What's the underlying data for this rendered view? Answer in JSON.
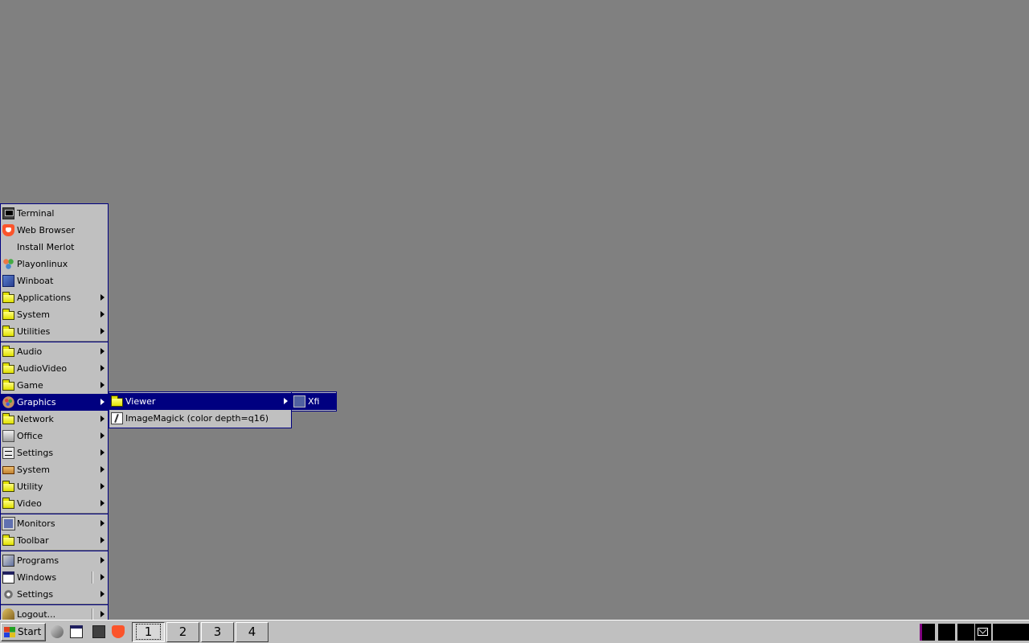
{
  "main_menu": {
    "section1": [
      {
        "label": "Terminal",
        "icon": "terminal-icon",
        "submenu": false
      },
      {
        "label": "Web Browser",
        "icon": "brave-icon",
        "submenu": false
      },
      {
        "label": "Install Merlot",
        "icon": "",
        "submenu": false
      },
      {
        "label": "Playonlinux",
        "icon": "playonlinux-icon",
        "submenu": false
      },
      {
        "label": "Winboat",
        "icon": "winboat-icon",
        "submenu": false
      },
      {
        "label": "Applications",
        "icon": "folder-icon",
        "submenu": true
      },
      {
        "label": "System",
        "icon": "folder-icon",
        "submenu": true
      },
      {
        "label": "Utilities",
        "icon": "folder-icon",
        "submenu": true
      }
    ],
    "section2": [
      {
        "label": "Audio",
        "icon": "folder-icon",
        "submenu": true
      },
      {
        "label": "AudioVideo",
        "icon": "folder-icon",
        "submenu": true
      },
      {
        "label": "Game",
        "icon": "folder-icon",
        "submenu": true
      },
      {
        "label": "Graphics",
        "icon": "graphics-icon",
        "submenu": true,
        "active": true
      },
      {
        "label": "Network",
        "icon": "folder-icon",
        "submenu": true
      },
      {
        "label": "Office",
        "icon": "office-icon",
        "submenu": true
      },
      {
        "label": "Settings",
        "icon": "settings-icon",
        "submenu": true
      },
      {
        "label": "System",
        "icon": "system-icon",
        "submenu": true
      },
      {
        "label": "Utility",
        "icon": "folder-icon",
        "submenu": true
      },
      {
        "label": "Video",
        "icon": "folder-icon",
        "submenu": true
      }
    ],
    "section3": [
      {
        "label": "Monitors",
        "icon": "monitor-icon",
        "submenu": true
      },
      {
        "label": "Toolbar",
        "icon": "folder-icon",
        "submenu": true
      }
    ],
    "section4": [
      {
        "label": "Programs",
        "icon": "programs-icon",
        "submenu": true
      },
      {
        "label": "Windows",
        "icon": "windows-icon",
        "submenu": true
      },
      {
        "label": "Settings",
        "icon": "gear-icon",
        "submenu": true
      }
    ],
    "section5": [
      {
        "label": "Logout...",
        "icon": "logout-icon",
        "submenu": true
      }
    ]
  },
  "graphics_menu": [
    {
      "label": "Viewer",
      "icon": "folder-icon",
      "submenu": true,
      "active": true
    },
    {
      "label": "ImageMagick (color depth=q16)",
      "icon": "imagemagick-icon",
      "submenu": false
    }
  ],
  "viewer_menu": [
    {
      "label": "Xfi",
      "icon": "xfi-icon",
      "submenu": false,
      "active": true
    }
  ],
  "taskbar": {
    "start_label": "Start",
    "workspaces": [
      "1",
      "2",
      "3",
      "4"
    ],
    "active_workspace": "1"
  },
  "colors": {
    "desktop": "#808080",
    "menu_bg": "#c0c0c0",
    "highlight": "#000080"
  }
}
